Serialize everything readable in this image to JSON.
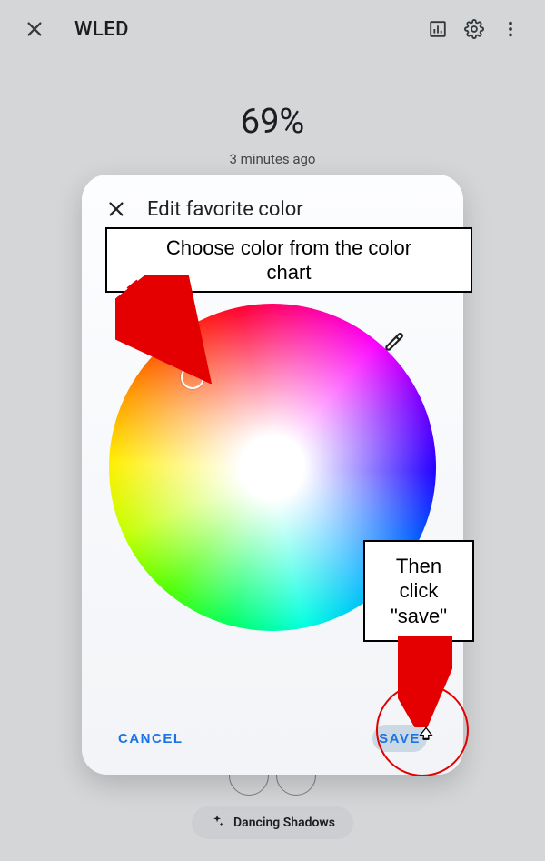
{
  "topbar": {
    "title": "WLED"
  },
  "background": {
    "percent": "69%",
    "timestamp": "3 minutes ago",
    "chip_label": "Dancing Shadows"
  },
  "modal": {
    "title": "Edit favorite color",
    "cancel_label": "CANCEL",
    "save_label": "SAVE"
  },
  "annotations": {
    "step1_line1": "Choose color from the color",
    "step1_line2": "chart",
    "step2_line1": "Then",
    "step2_line2": "click",
    "step2_line3": "\"save\""
  }
}
